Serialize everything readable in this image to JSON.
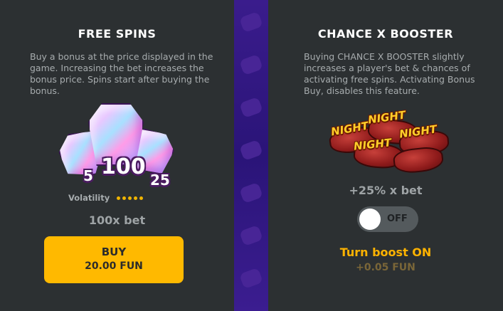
{
  "free_spins": {
    "title": "FREE SPINS",
    "description": "Buy a bonus at the price displayed in the game. Increasing the bet increases the bonus price. Spins start after buying the bonus.",
    "gem_values": [
      "5",
      "100",
      "25"
    ],
    "volatility_label": "Volatility",
    "volatility_level": 5,
    "bet_multiplier": "100x bet",
    "buy_button": {
      "label": "BUY",
      "price": "20.00 FUN"
    }
  },
  "chance_booster": {
    "title": "CHANCE X BOOSTER",
    "description": "Buying CHANCE X BOOSTER slightly increases a player's bet & chances of activating free spins. Activating Bonus Buy, disables this feature.",
    "pillow_words": [
      "NIGHT",
      "NIGHT",
      "NIGHT",
      "NIGHT"
    ],
    "bet_increase": "+25% x bet",
    "toggle_state": "OFF",
    "turn_on_label": "Turn boost ON",
    "boost_price": "+0.05 FUN"
  },
  "colors": {
    "panel_bg": "#2c3032",
    "divider": "#2a1478",
    "buy_button": "#ffb900",
    "accent_text": "#ffb300",
    "muted_text": "#a7acae"
  }
}
